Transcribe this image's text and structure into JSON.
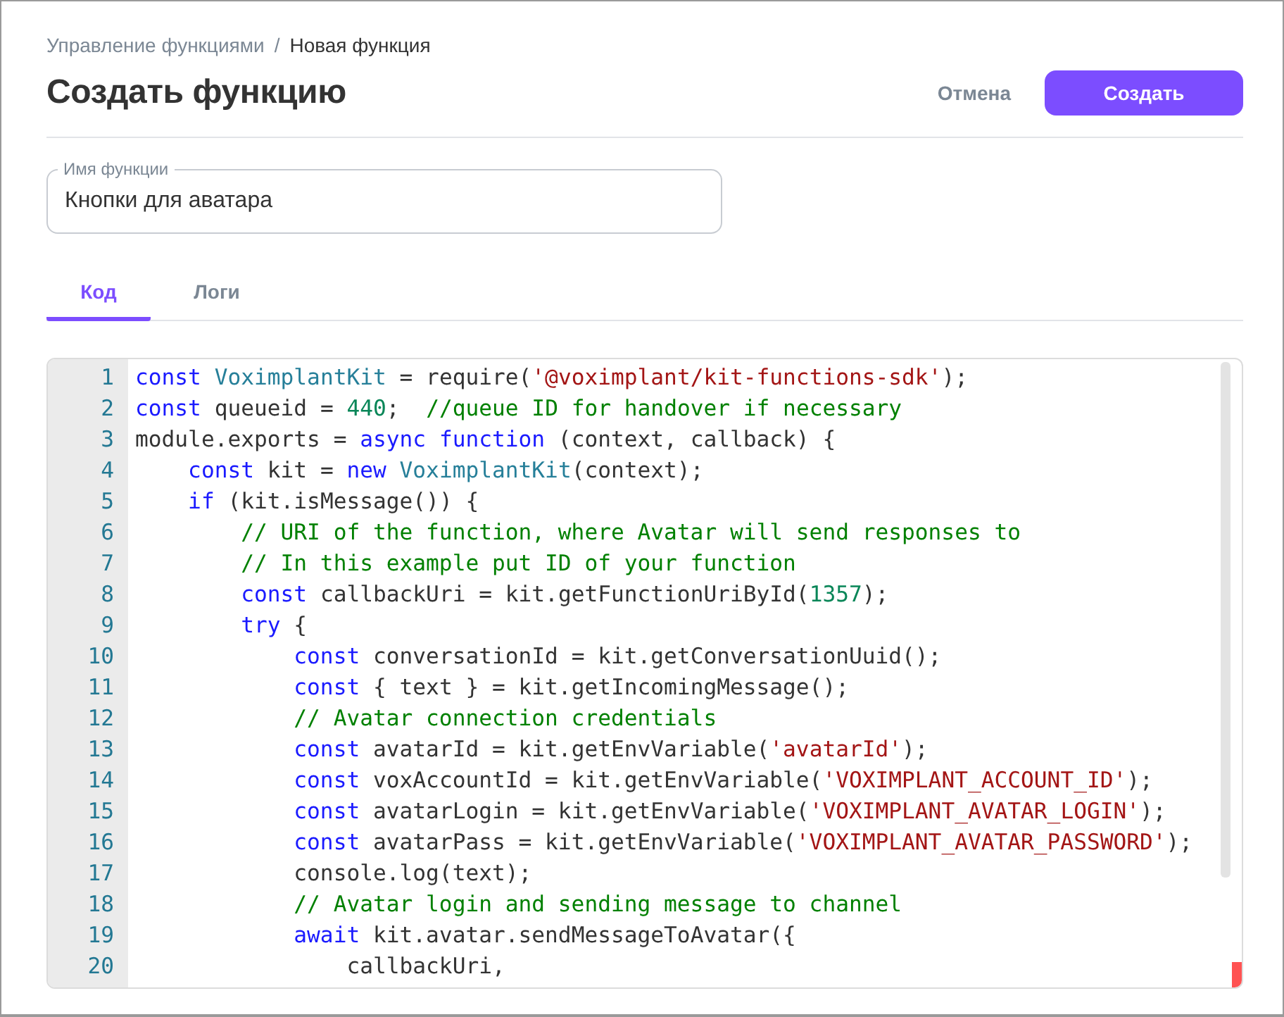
{
  "breadcrumb": [
    {
      "label": "Управление функциями",
      "current": false
    },
    {
      "label": "Новая функция",
      "current": true
    }
  ],
  "breadcrumb_separator": "/",
  "title": "Создать функцию",
  "actions": [
    {
      "kind": "text",
      "label": "Отмена"
    },
    {
      "kind": "primary",
      "label": "Создать"
    }
  ],
  "name_field": {
    "label": "Имя функции",
    "value": "Кнопки для аватара"
  },
  "tabs": [
    {
      "label": "Код",
      "selected": true
    },
    {
      "label": "Логи",
      "selected": false
    }
  ],
  "code": [
    {
      "number": "1",
      "tokens": [
        {
          "kind": "keyword",
          "text": "const"
        },
        {
          "kind": "type",
          "text": " VoximplantKit"
        },
        {
          "kind": "plain",
          "text": " = require("
        },
        {
          "kind": "string",
          "text": "'@voximplant/kit-functions-sdk'"
        },
        {
          "kind": "plain",
          "text": ");"
        }
      ]
    },
    {
      "number": "2",
      "tokens": [
        {
          "kind": "keyword",
          "text": "const"
        },
        {
          "kind": "plain",
          "text": " queueid = "
        },
        {
          "kind": "number",
          "text": "440"
        },
        {
          "kind": "plain",
          "text": ";  "
        },
        {
          "kind": "comment",
          "text": "//queue ID for handover if necessary"
        }
      ]
    },
    {
      "number": "3",
      "tokens": [
        {
          "kind": "plain",
          "text": "module.exports = "
        },
        {
          "kind": "keyword",
          "text": "async function"
        },
        {
          "kind": "plain",
          "text": " (context, callback) {"
        }
      ]
    },
    {
      "number": "4",
      "tokens": [
        {
          "kind": "keyword",
          "text": "    const"
        },
        {
          "kind": "plain",
          "text": " kit = "
        },
        {
          "kind": "keyword",
          "text": "new"
        },
        {
          "kind": "type",
          "text": " VoximplantKit"
        },
        {
          "kind": "plain",
          "text": "(context);"
        }
      ]
    },
    {
      "number": "5",
      "tokens": [
        {
          "kind": "keyword",
          "text": "    if"
        },
        {
          "kind": "plain",
          "text": " (kit.isMessage()) {"
        }
      ]
    },
    {
      "number": "6",
      "tokens": [
        {
          "kind": "comment",
          "text": "        // URI of the function, where Avatar will send responses to"
        }
      ]
    },
    {
      "number": "7",
      "tokens": [
        {
          "kind": "comment",
          "text": "        // In this example put ID of your function"
        }
      ]
    },
    {
      "number": "8",
      "tokens": [
        {
          "kind": "keyword",
          "text": "        const"
        },
        {
          "kind": "plain",
          "text": " callbackUri = kit.getFunctionUriById("
        },
        {
          "kind": "number",
          "text": "1357"
        },
        {
          "kind": "plain",
          "text": ");"
        }
      ]
    },
    {
      "number": "9",
      "tokens": [
        {
          "kind": "keyword",
          "text": "        try"
        },
        {
          "kind": "plain",
          "text": " {"
        }
      ]
    },
    {
      "number": "10",
      "tokens": [
        {
          "kind": "keyword",
          "text": "            const"
        },
        {
          "kind": "plain",
          "text": " conversationId = kit.getConversationUuid();"
        }
      ]
    },
    {
      "number": "11",
      "tokens": [
        {
          "kind": "keyword",
          "text": "            const"
        },
        {
          "kind": "plain",
          "text": " { text } = kit.getIncomingMessage();"
        }
      ]
    },
    {
      "number": "12",
      "tokens": [
        {
          "kind": "comment",
          "text": "            // Avatar connection credentials"
        }
      ]
    },
    {
      "number": "13",
      "tokens": [
        {
          "kind": "keyword",
          "text": "            const"
        },
        {
          "kind": "plain",
          "text": " avatarId = kit.getEnvVariable("
        },
        {
          "kind": "string",
          "text": "'avatarId'"
        },
        {
          "kind": "plain",
          "text": ");"
        }
      ]
    },
    {
      "number": "14",
      "tokens": [
        {
          "kind": "keyword",
          "text": "            const"
        },
        {
          "kind": "plain",
          "text": " voxAccountId = kit.getEnvVariable("
        },
        {
          "kind": "string",
          "text": "'VOXIMPLANT_ACCOUNT_ID'"
        },
        {
          "kind": "plain",
          "text": ");"
        }
      ]
    },
    {
      "number": "15",
      "tokens": [
        {
          "kind": "keyword",
          "text": "            const"
        },
        {
          "kind": "plain",
          "text": " avatarLogin = kit.getEnvVariable("
        },
        {
          "kind": "string",
          "text": "'VOXIMPLANT_AVATAR_LOGIN'"
        },
        {
          "kind": "plain",
          "text": ");"
        }
      ]
    },
    {
      "number": "16",
      "tokens": [
        {
          "kind": "keyword",
          "text": "            const"
        },
        {
          "kind": "plain",
          "text": " avatarPass = kit.getEnvVariable("
        },
        {
          "kind": "string",
          "text": "'VOXIMPLANT_AVATAR_PASSWORD'"
        },
        {
          "kind": "plain",
          "text": ");"
        }
      ]
    },
    {
      "number": "17",
      "tokens": [
        {
          "kind": "plain",
          "text": "            console.log(text);"
        }
      ]
    },
    {
      "number": "18",
      "tokens": [
        {
          "kind": "comment",
          "text": "            // Avatar login and sending message to channel"
        }
      ]
    },
    {
      "number": "19",
      "tokens": [
        {
          "kind": "keyword",
          "text": "            await"
        },
        {
          "kind": "plain",
          "text": " kit.avatar.sendMessageToAvatar({"
        }
      ]
    },
    {
      "number": "20",
      "tokens": [
        {
          "kind": "plain",
          "text": "                callbackUri,"
        }
      ]
    }
  ]
}
